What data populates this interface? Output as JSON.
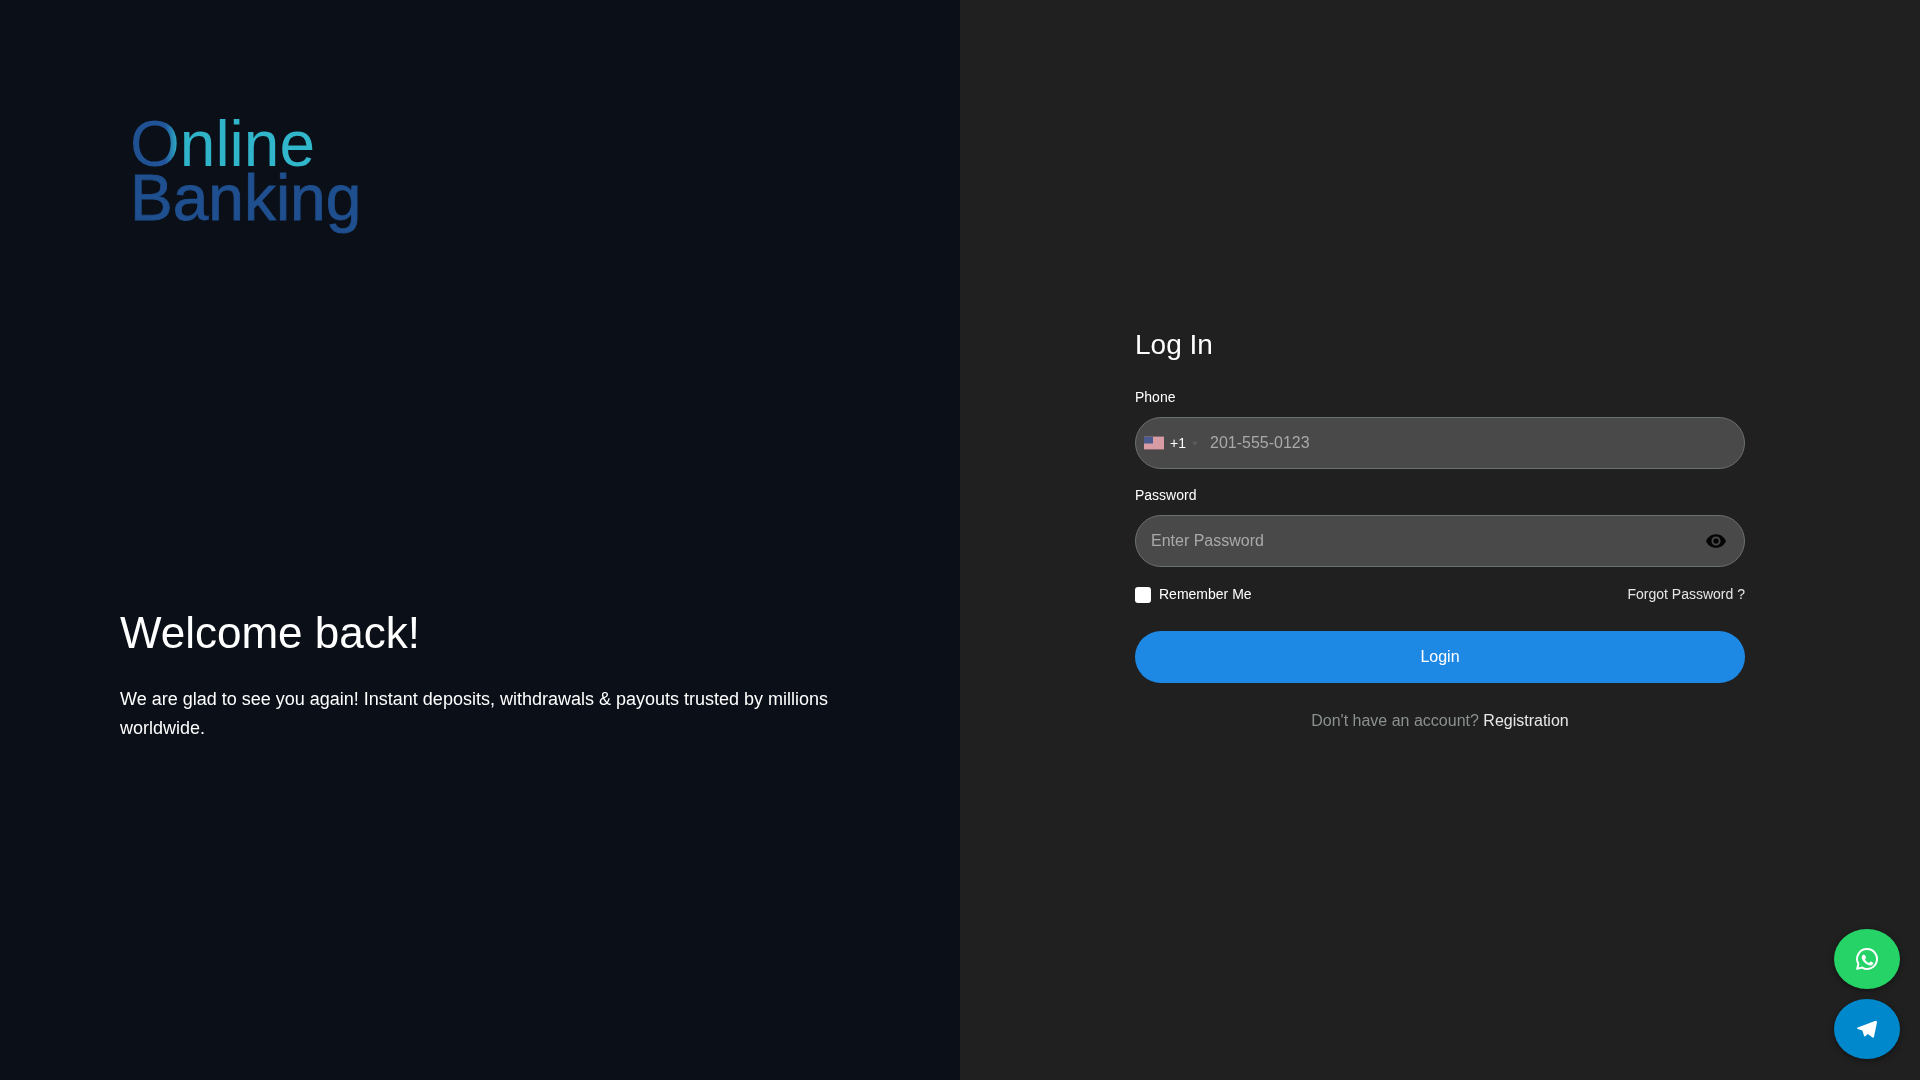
{
  "logo": {
    "lines": [
      "Online",
      "Banking"
    ]
  },
  "welcome": {
    "title": "Welcome back!",
    "text": "We are glad to see you again! Instant deposits, withdrawals & payouts trusted by millions worldwide."
  },
  "login_form": {
    "title": "Log In",
    "phone": {
      "label": "Phone",
      "country_code": "+1",
      "placeholder": "201-555-0123"
    },
    "password": {
      "label": "Password",
      "placeholder": "Enter Password"
    },
    "remember_me": {
      "label": "Remember Me",
      "checked": false
    },
    "forgot_password": "Forgot Password ?",
    "submit": "Login",
    "signup_prompt": {
      "text": "Don't have an account?",
      "link": "Registration"
    }
  },
  "contact_buttons": [
    {
      "kind": "chat",
      "color": "#25d366"
    },
    {
      "kind": "send",
      "color": "#0088cc"
    }
  ]
}
